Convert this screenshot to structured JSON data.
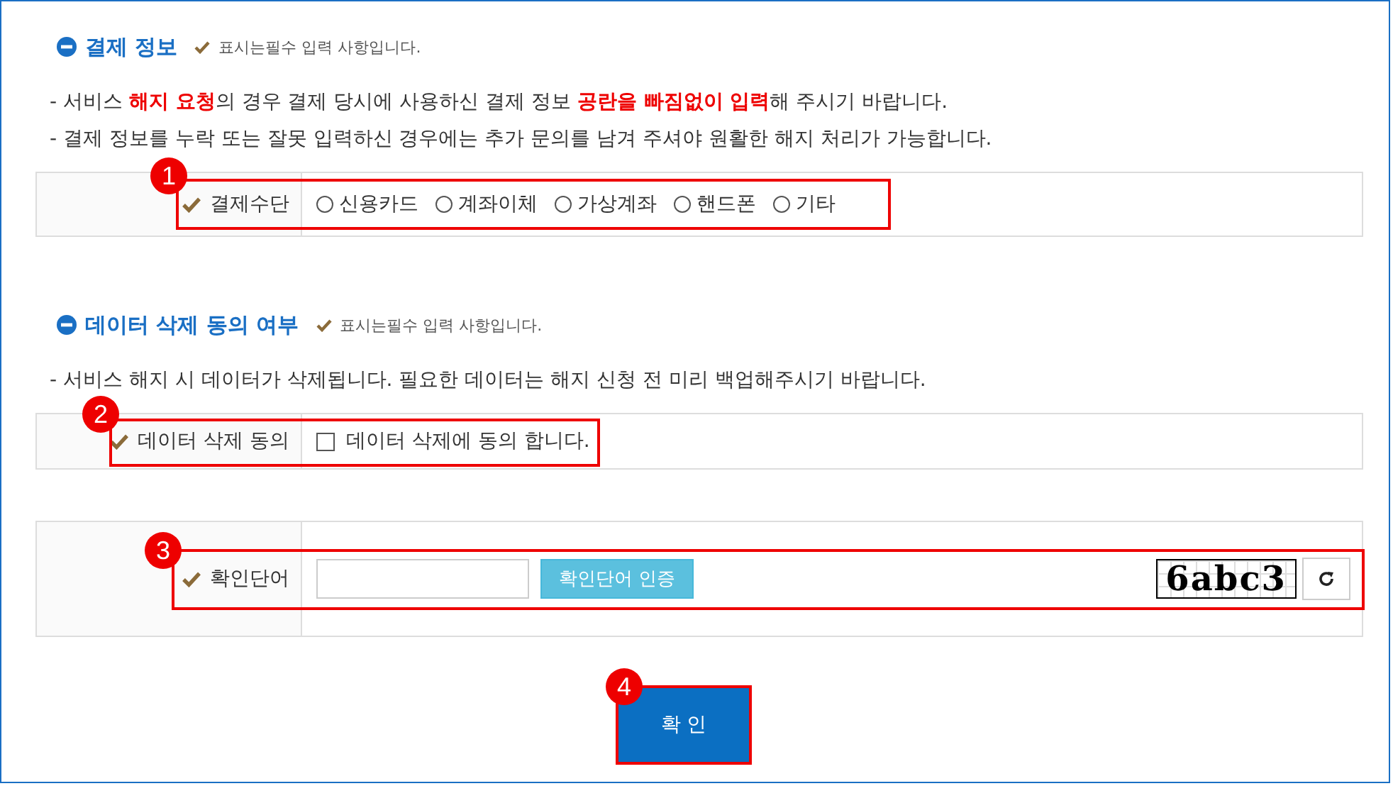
{
  "sections": [
    {
      "title": "결제 정보",
      "required_note": "표시는필수 입력 사항입니다.",
      "notes": [
        "- 서비스 **해지 요청**의 경우 결제 당시에 사용하신 결제 정보 **공란을 빠짐없이 입력**해 주시기 바랍니다.",
        "- 결제 정보를 누락 또는 잘못 입력하신 경우에는 추가 문의를 남겨 주셔야 원활한 해지 처리가 가능합니다."
      ],
      "row": {
        "kind": "radio",
        "label": "결제수단",
        "marker": "1",
        "options": [
          {
            "label": "신용카드",
            "selected": false
          },
          {
            "label": "계좌이체",
            "selected": false
          },
          {
            "label": "가상계좌",
            "selected": false
          },
          {
            "label": "핸드폰",
            "selected": false
          },
          {
            "label": "기타",
            "selected": false
          }
        ]
      }
    },
    {
      "title": "데이터 삭제 동의 여부",
      "required_note": "표시는필수 입력 사항입니다.",
      "notes": [
        "- 서비스 해지 시 데이터가 삭제됩니다. 필요한 데이터는 해지 신청 전 미리 백업해주시기 바랍니다."
      ],
      "row": {
        "kind": "checkbox",
        "label": "데이터 삭제 동의",
        "marker": "2",
        "option": {
          "label": "데이터 삭제에 동의 합니다.",
          "checked": false
        }
      }
    }
  ],
  "captcha_row": {
    "label": "확인단어",
    "marker": "3",
    "verify_button": "확인단어 인증",
    "captcha": "6abc3"
  },
  "submit": {
    "label": "확 인",
    "marker": "4"
  }
}
